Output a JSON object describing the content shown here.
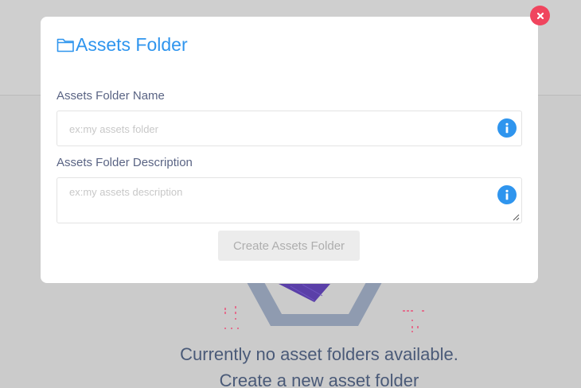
{
  "modal": {
    "title": "Assets Folder",
    "name_label": "Assets Folder Name",
    "name_placeholder": "ex:my assets folder",
    "name_value": "",
    "description_label": "Assets Folder Description",
    "description_placeholder": "ex:my assets description",
    "description_value": "",
    "submit_label": "Create Assets Folder",
    "submit_disabled": true,
    "close_icon": "close-icon",
    "title_icon": "folder-icon",
    "info_icon": "info-icon"
  },
  "empty_state": {
    "line1": "Currently no asset folders available.",
    "line2": "Create a new asset folder"
  },
  "colors": {
    "accent": "#2f95ee",
    "close": "#f0455e",
    "overlay": "#cfcfcf",
    "text_muted": "#5a6484"
  }
}
